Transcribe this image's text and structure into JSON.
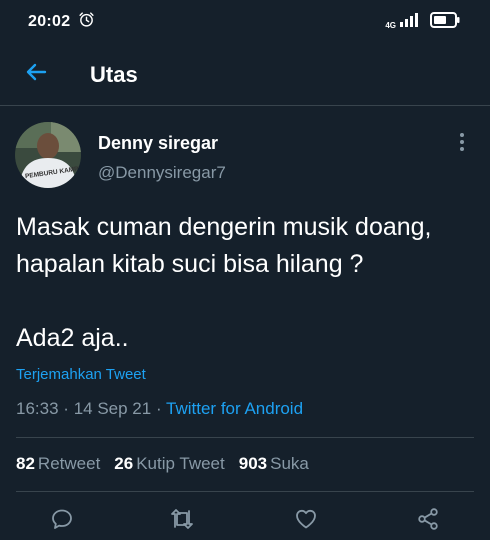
{
  "status_bar": {
    "time": "20:02",
    "network": "4G",
    "icons": [
      "alarm-icon",
      "signal-icon",
      "battery-icon"
    ]
  },
  "header": {
    "title": "Utas",
    "back_icon": "arrow-left-icon"
  },
  "tweet": {
    "author_name": "Denny siregar",
    "author_handle": "@Dennysiregar7",
    "avatar_shirt_text": "PEMBURU KAMPRET",
    "text_lines": [
      "Masak cuman dengerin musik doang,",
      "hapalan kitab suci bisa hilang ?",
      "Ada2 aja.."
    ],
    "translate_label": "Terjemahkan Tweet",
    "time": "16:33",
    "separator": "·",
    "date": "14 Sep 21",
    "source": "Twitter for Android",
    "stats": {
      "retweets_count": "82",
      "retweets_label": "Retweet",
      "quotes_count": "26",
      "quotes_label": "Kutip Tweet",
      "likes_count": "903",
      "likes_label": "Suka"
    },
    "actions": [
      "reply-icon",
      "retweet-icon",
      "like-icon",
      "share-icon"
    ]
  },
  "colors": {
    "background": "#15202b",
    "text_primary": "#ffffff",
    "text_secondary": "#8899a6",
    "accent": "#1da1f2",
    "divider": "#38444d"
  }
}
